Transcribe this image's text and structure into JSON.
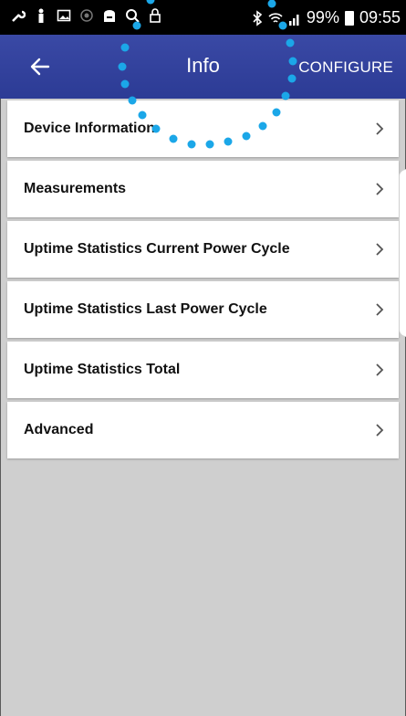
{
  "status_bar": {
    "battery": "99%",
    "time": "09:55",
    "icons": [
      "wrench-icon",
      "person-icon",
      "image-icon",
      "circle-icon",
      "toast-icon",
      "search-icon",
      "lock-icon",
      "bluetooth-icon",
      "wifi-icon",
      "signal-icon",
      "battery-icon"
    ]
  },
  "app_bar": {
    "title": "Info",
    "action": "CONFIGURE",
    "back_icon": "arrow-left-icon"
  },
  "list": {
    "items": [
      {
        "label": "Device Information"
      },
      {
        "label": "Measurements"
      },
      {
        "label": "Uptime Statistics Current Power Cycle"
      },
      {
        "label": "Uptime Statistics Last Power Cycle"
      },
      {
        "label": "Uptime Statistics Total"
      },
      {
        "label": "Advanced"
      }
    ]
  },
  "colors": {
    "app_bar": "#2f3e9a",
    "highlight_dots": "#1ba7e8",
    "background": "#cfcfcf"
  }
}
